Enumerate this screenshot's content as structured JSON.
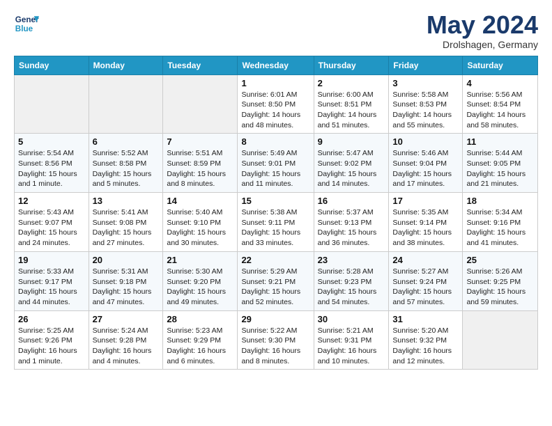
{
  "header": {
    "logo_line1": "General",
    "logo_line2": "Blue",
    "month": "May 2024",
    "location": "Drolshagen, Germany"
  },
  "columns": [
    "Sunday",
    "Monday",
    "Tuesday",
    "Wednesday",
    "Thursday",
    "Friday",
    "Saturday"
  ],
  "weeks": [
    [
      {
        "empty": true
      },
      {
        "empty": true
      },
      {
        "empty": true
      },
      {
        "day": "1",
        "sunrise": "6:01 AM",
        "sunset": "8:50 PM",
        "daylight": "14 hours and 48 minutes."
      },
      {
        "day": "2",
        "sunrise": "6:00 AM",
        "sunset": "8:51 PM",
        "daylight": "14 hours and 51 minutes."
      },
      {
        "day": "3",
        "sunrise": "5:58 AM",
        "sunset": "8:53 PM",
        "daylight": "14 hours and 55 minutes."
      },
      {
        "day": "4",
        "sunrise": "5:56 AM",
        "sunset": "8:54 PM",
        "daylight": "14 hours and 58 minutes."
      }
    ],
    [
      {
        "day": "5",
        "sunrise": "5:54 AM",
        "sunset": "8:56 PM",
        "daylight": "15 hours and 1 minute."
      },
      {
        "day": "6",
        "sunrise": "5:52 AM",
        "sunset": "8:58 PM",
        "daylight": "15 hours and 5 minutes."
      },
      {
        "day": "7",
        "sunrise": "5:51 AM",
        "sunset": "8:59 PM",
        "daylight": "15 hours and 8 minutes."
      },
      {
        "day": "8",
        "sunrise": "5:49 AM",
        "sunset": "9:01 PM",
        "daylight": "15 hours and 11 minutes."
      },
      {
        "day": "9",
        "sunrise": "5:47 AM",
        "sunset": "9:02 PM",
        "daylight": "15 hours and 14 minutes."
      },
      {
        "day": "10",
        "sunrise": "5:46 AM",
        "sunset": "9:04 PM",
        "daylight": "15 hours and 17 minutes."
      },
      {
        "day": "11",
        "sunrise": "5:44 AM",
        "sunset": "9:05 PM",
        "daylight": "15 hours and 21 minutes."
      }
    ],
    [
      {
        "day": "12",
        "sunrise": "5:43 AM",
        "sunset": "9:07 PM",
        "daylight": "15 hours and 24 minutes."
      },
      {
        "day": "13",
        "sunrise": "5:41 AM",
        "sunset": "9:08 PM",
        "daylight": "15 hours and 27 minutes."
      },
      {
        "day": "14",
        "sunrise": "5:40 AM",
        "sunset": "9:10 PM",
        "daylight": "15 hours and 30 minutes."
      },
      {
        "day": "15",
        "sunrise": "5:38 AM",
        "sunset": "9:11 PM",
        "daylight": "15 hours and 33 minutes."
      },
      {
        "day": "16",
        "sunrise": "5:37 AM",
        "sunset": "9:13 PM",
        "daylight": "15 hours and 36 minutes."
      },
      {
        "day": "17",
        "sunrise": "5:35 AM",
        "sunset": "9:14 PM",
        "daylight": "15 hours and 38 minutes."
      },
      {
        "day": "18",
        "sunrise": "5:34 AM",
        "sunset": "9:16 PM",
        "daylight": "15 hours and 41 minutes."
      }
    ],
    [
      {
        "day": "19",
        "sunrise": "5:33 AM",
        "sunset": "9:17 PM",
        "daylight": "15 hours and 44 minutes."
      },
      {
        "day": "20",
        "sunrise": "5:31 AM",
        "sunset": "9:18 PM",
        "daylight": "15 hours and 47 minutes."
      },
      {
        "day": "21",
        "sunrise": "5:30 AM",
        "sunset": "9:20 PM",
        "daylight": "15 hours and 49 minutes."
      },
      {
        "day": "22",
        "sunrise": "5:29 AM",
        "sunset": "9:21 PM",
        "daylight": "15 hours and 52 minutes."
      },
      {
        "day": "23",
        "sunrise": "5:28 AM",
        "sunset": "9:23 PM",
        "daylight": "15 hours and 54 minutes."
      },
      {
        "day": "24",
        "sunrise": "5:27 AM",
        "sunset": "9:24 PM",
        "daylight": "15 hours and 57 minutes."
      },
      {
        "day": "25",
        "sunrise": "5:26 AM",
        "sunset": "9:25 PM",
        "daylight": "15 hours and 59 minutes."
      }
    ],
    [
      {
        "day": "26",
        "sunrise": "5:25 AM",
        "sunset": "9:26 PM",
        "daylight": "16 hours and 1 minute."
      },
      {
        "day": "27",
        "sunrise": "5:24 AM",
        "sunset": "9:28 PM",
        "daylight": "16 hours and 4 minutes."
      },
      {
        "day": "28",
        "sunrise": "5:23 AM",
        "sunset": "9:29 PM",
        "daylight": "16 hours and 6 minutes."
      },
      {
        "day": "29",
        "sunrise": "5:22 AM",
        "sunset": "9:30 PM",
        "daylight": "16 hours and 8 minutes."
      },
      {
        "day": "30",
        "sunrise": "5:21 AM",
        "sunset": "9:31 PM",
        "daylight": "16 hours and 10 minutes."
      },
      {
        "day": "31",
        "sunrise": "5:20 AM",
        "sunset": "9:32 PM",
        "daylight": "16 hours and 12 minutes."
      },
      {
        "empty": true
      }
    ]
  ]
}
